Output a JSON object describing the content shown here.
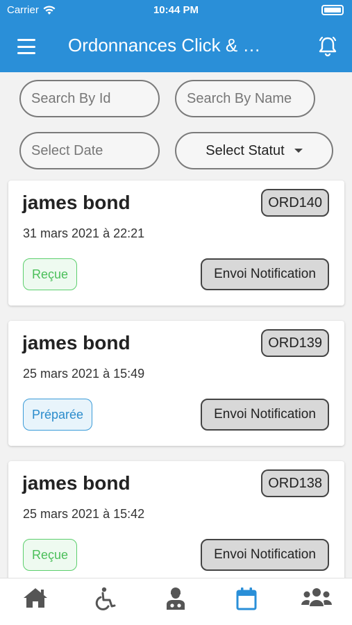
{
  "status_bar": {
    "carrier": "Carrier",
    "time": "10:44 PM"
  },
  "app_bar": {
    "title": "Ordonnances Click & …",
    "menu_icon": "menu-icon",
    "notification_icon": "bell-icon"
  },
  "filters": {
    "search_id_placeholder": "Search By Id",
    "search_name_placeholder": "Search By Name",
    "select_date_placeholder": "Select Date",
    "select_statut_label": "Select Statut"
  },
  "orders": [
    {
      "name": "james bond",
      "id": "ORD140",
      "date": "31 mars 2021 à 22:21",
      "status": "Reçue",
      "action": "Envoi Notification"
    },
    {
      "name": "james bond",
      "id": "ORD139",
      "date": "25 mars 2021 à 15:49",
      "status": "Préparée",
      "action": "Envoi Notification"
    },
    {
      "name": "james bond",
      "id": "ORD138",
      "date": "25 mars 2021 à 15:42",
      "status": "Reçue",
      "action": "Envoi Notification"
    }
  ],
  "bottom_nav": [
    "home-icon",
    "wheelchair-icon",
    "doctor-icon",
    "calendar-icon",
    "users-icon"
  ],
  "colors": {
    "primary": "#2a8fd8",
    "recue": "#4bbf5a",
    "preparee": "#2b8ccc",
    "active_nav": "#2a8fd8",
    "inactive_nav": "#555555"
  }
}
